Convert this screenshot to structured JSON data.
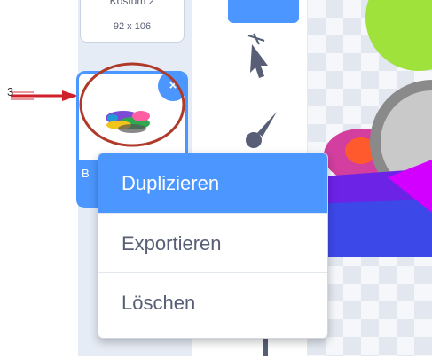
{
  "costume_list": {
    "top_tile": {
      "name": "Kostüm 2",
      "size": "92 x 106"
    },
    "selected_tile": {
      "number": "3",
      "label_partial": "B"
    }
  },
  "context_menu": {
    "items": [
      {
        "label": "Duplizieren",
        "highlighted": true
      },
      {
        "label": "Exportieren",
        "highlighted": false
      },
      {
        "label": "Löschen",
        "highlighted": false
      }
    ]
  },
  "colors": {
    "accent": "#4c97ff",
    "annotation": "#d0202a",
    "menu_text": "#575e75"
  },
  "icons": [
    "select-arrow-icon",
    "brush-icon",
    "delete-x-icon",
    "red-arrow-annotation",
    "red-ellipse-annotation"
  ]
}
